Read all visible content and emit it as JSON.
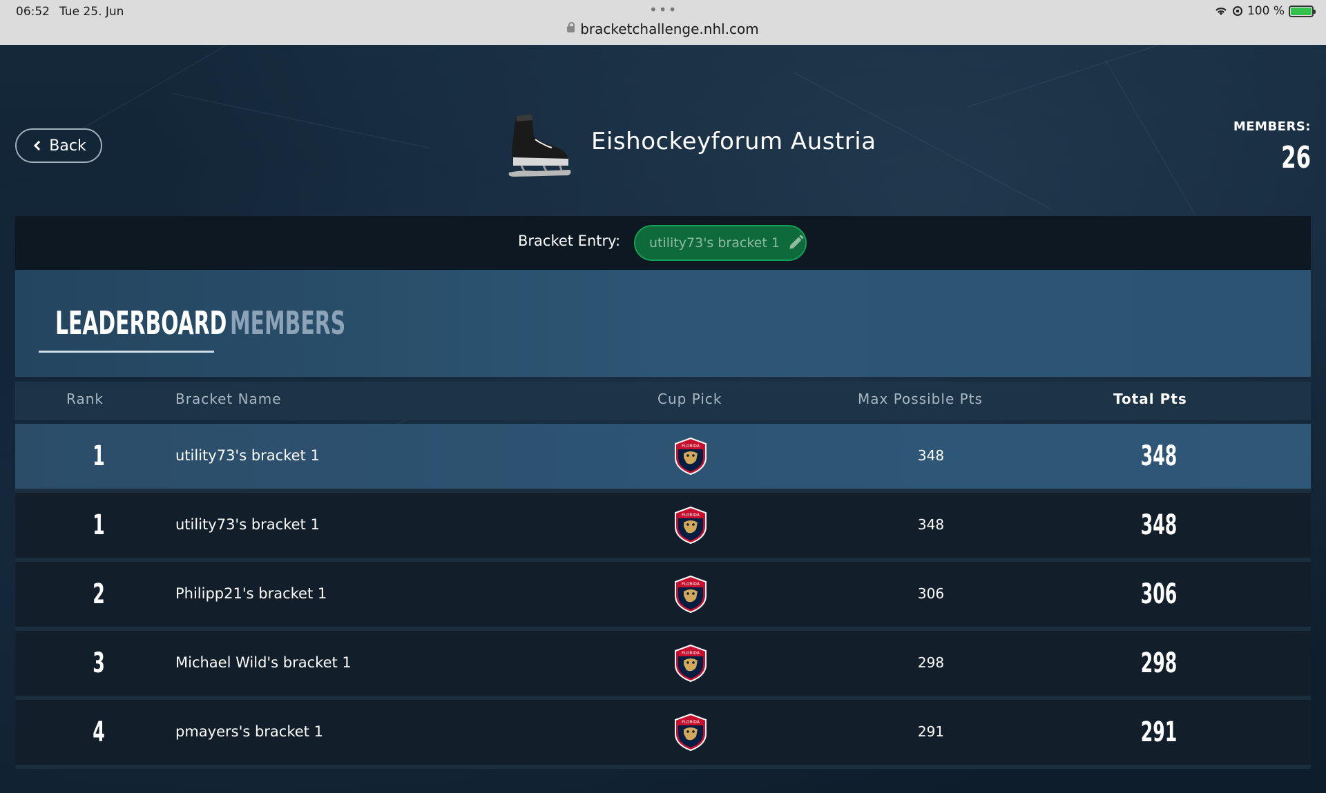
{
  "status": {
    "time": "06:52",
    "date": "Tue 25. Jun",
    "battery": "100 %",
    "url": "bracketchallenge.nhl.com"
  },
  "header": {
    "back_label": "Back",
    "group_name": "Eishockeyforum Austria",
    "members_label": "MEMBERS:",
    "members_count": "26"
  },
  "entry": {
    "label": "Bracket Entry:",
    "value": "utility73's bracket 1"
  },
  "tabs": [
    {
      "label": "LEADERBOARD",
      "active": true
    },
    {
      "label": "MEMBERS",
      "active": false
    }
  ],
  "table": {
    "columns": [
      "Rank",
      "Bracket Name",
      "Cup Pick",
      "Max Possible Pts",
      "Total Pts"
    ],
    "rows": [
      {
        "rank": "1",
        "name": "utility73's bracket 1",
        "cup_pick": "florida-panthers-logo",
        "max": "348",
        "total": "348",
        "highlight": true
      },
      {
        "rank": "1",
        "name": "utility73's bracket 1",
        "cup_pick": "florida-panthers-logo",
        "max": "348",
        "total": "348",
        "highlight": false
      },
      {
        "rank": "2",
        "name": "Philipp21's bracket 1",
        "cup_pick": "florida-panthers-logo",
        "max": "306",
        "total": "306",
        "highlight": false
      },
      {
        "rank": "3",
        "name": "Michael Wild's bracket 1",
        "cup_pick": "florida-panthers-logo",
        "max": "298",
        "total": "298",
        "highlight": false
      },
      {
        "rank": "4",
        "name": "pmayers's bracket 1",
        "cup_pick": "florida-panthers-logo",
        "max": "291",
        "total": "291",
        "highlight": false
      }
    ]
  },
  "colors": {
    "accent_green": "#0e6a3a",
    "highlight_row": "#2e5575",
    "background": "#0f1e2c"
  }
}
